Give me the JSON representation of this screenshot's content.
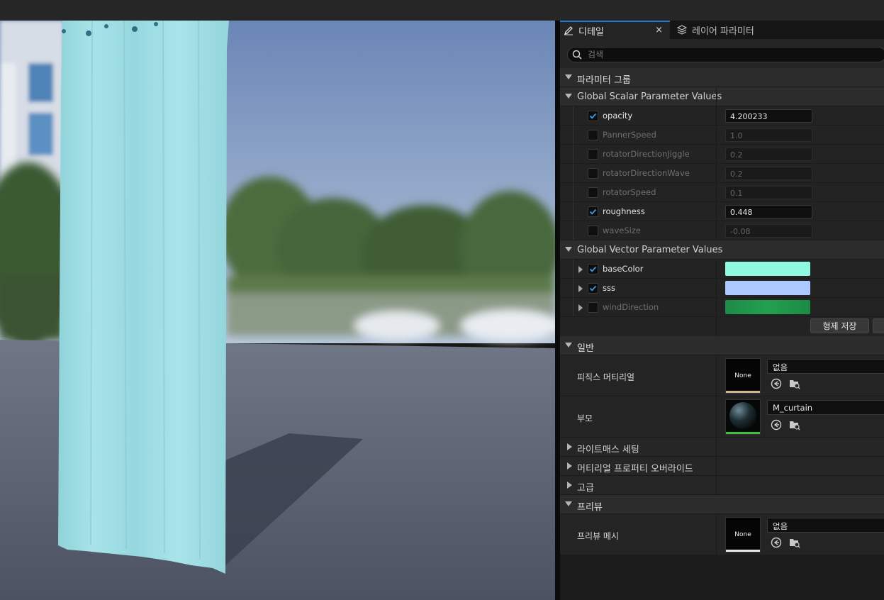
{
  "tabs": {
    "details": "디테일",
    "close": "×",
    "layer_params": "레이어 파라미터"
  },
  "search": {
    "placeholder": "검색"
  },
  "groups": {
    "param_group": "파라미터 그룹",
    "scalar": "Global Scalar Parameter Values",
    "vector": "Global Vector Parameter Values",
    "general": "일반",
    "lightmass": "라이트매스 세팅",
    "prop_override": "머티리얼 프로퍼티 오버라이드",
    "advanced": "고급",
    "preview": "프리뷰"
  },
  "scalar_params": [
    {
      "name": "opacity",
      "value": "4.200233",
      "enabled": true
    },
    {
      "name": "PannerSpeed",
      "value": "1.0",
      "enabled": false
    },
    {
      "name": "rotatorDirectionJiggle",
      "value": "0.2",
      "enabled": false
    },
    {
      "name": "rotatorDirectionWave",
      "value": "0.2",
      "enabled": false
    },
    {
      "name": "rotatorSpeed",
      "value": "0.1",
      "enabled": false
    },
    {
      "name": "roughness",
      "value": "0.448",
      "enabled": true
    },
    {
      "name": "waveSize",
      "value": "-0.08",
      "enabled": false
    }
  ],
  "vector_params": [
    {
      "name": "baseColor",
      "enabled": true,
      "color": "#8ffae0"
    },
    {
      "name": "sss",
      "enabled": true,
      "color": "#adc8ff"
    },
    {
      "name": "windDirection",
      "enabled": false,
      "color": "#1f9a4a"
    }
  ],
  "save_sibling_button": "형제 저장",
  "general": {
    "phys_label": "피직스 머티리얼",
    "phys_thumb": "None",
    "phys_value": "없음",
    "parent_label": "부모",
    "parent_value": "M_curtain"
  },
  "preview": {
    "mesh_label": "프리뷰 메시",
    "mesh_thumb": "None",
    "mesh_value": "없음"
  },
  "colors": {
    "accent": "#1f7ad6",
    "curtain": "#9fdde3",
    "checkbox_check": "#3d9be9"
  },
  "icons": [
    "pencil-icon",
    "layers-icon",
    "search-icon",
    "checkmark-icon",
    "arrow-left-circle-icon",
    "browse-folder-icon"
  ]
}
